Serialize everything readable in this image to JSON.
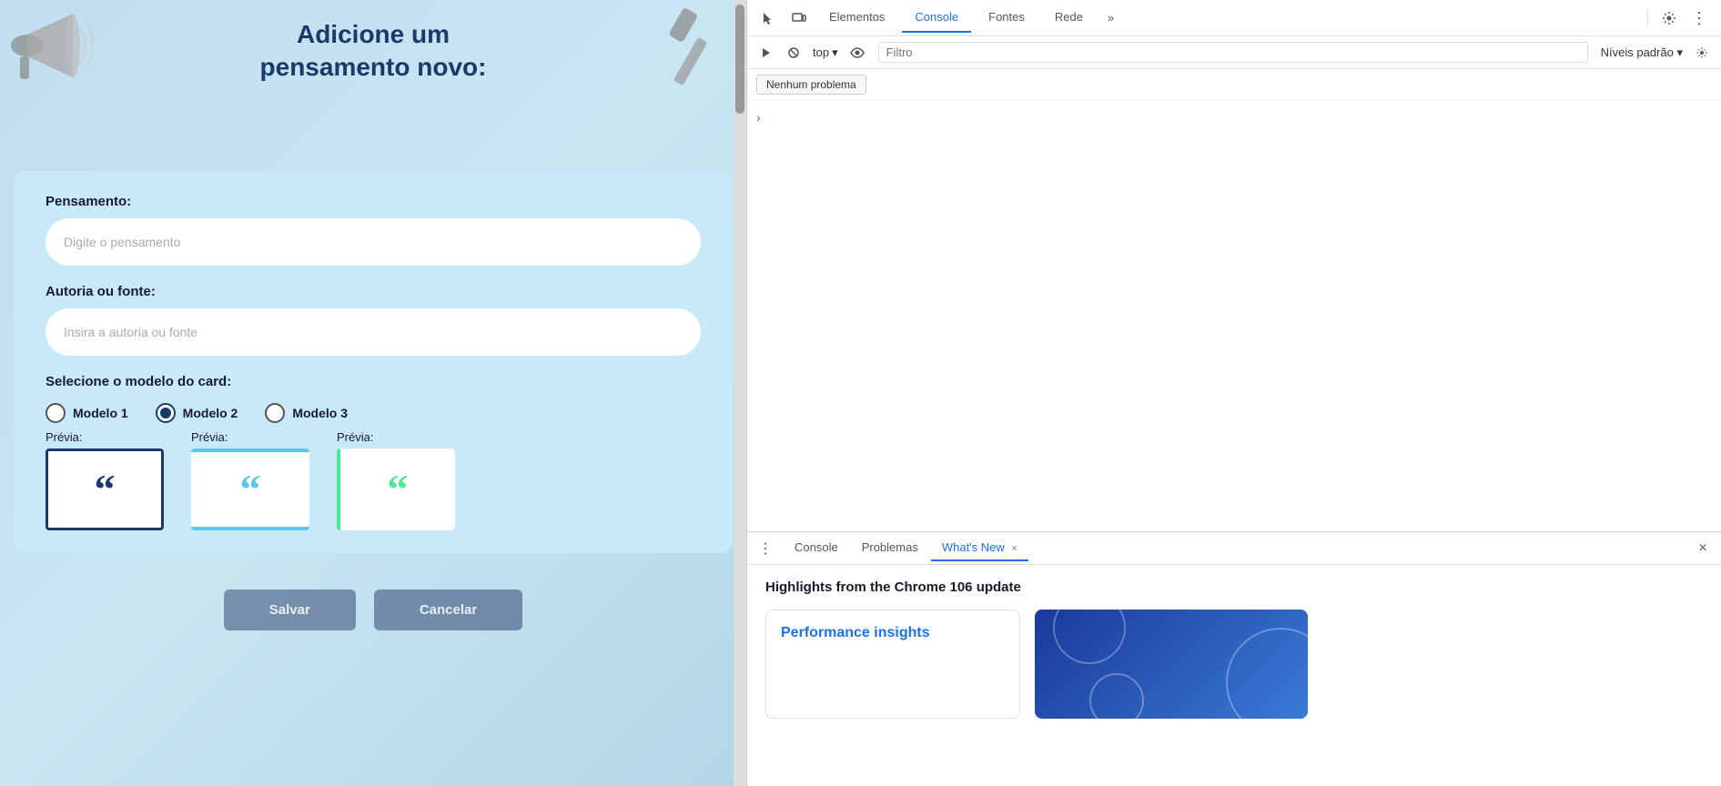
{
  "page": {
    "title_line1": "Adicione um",
    "title_line2": "pensamento novo:",
    "form": {
      "thought_label": "Pensamento:",
      "thought_placeholder": "Digite o pensamento",
      "author_label": "Autoria ou fonte:",
      "author_placeholder": "Insira a autoria ou fonte",
      "model_label": "Selecione o modelo do card:",
      "models": [
        {
          "id": "model1",
          "label": "Modelo 1",
          "selected": false
        },
        {
          "id": "model2",
          "label": "Modelo 2",
          "selected": true
        },
        {
          "id": "model3",
          "label": "Modelo 3",
          "selected": false
        }
      ],
      "preview_label": "Prévia:",
      "save_button": "Salvar",
      "cancel_button": "Cancelar"
    }
  },
  "devtools": {
    "tabs": [
      {
        "id": "elementos",
        "label": "Elementos",
        "active": false
      },
      {
        "id": "console",
        "label": "Console",
        "active": true
      },
      {
        "id": "fontes",
        "label": "Fontes",
        "active": false
      },
      {
        "id": "rede",
        "label": "Rede",
        "active": false
      }
    ],
    "more_tabs": "»",
    "toolbar": {
      "top_label": "top",
      "filter_placeholder": "Filtro",
      "levels_label": "Níveis padrão"
    },
    "no_problem_btn": "Nenhum problema",
    "console_output": {
      "has_arrow": true
    }
  },
  "bottom_panel": {
    "tabs": [
      {
        "id": "console",
        "label": "Console",
        "active": false,
        "closeable": false
      },
      {
        "id": "problemas",
        "label": "Problemas",
        "active": false,
        "closeable": false
      },
      {
        "id": "whats-new",
        "label": "What's New",
        "active": true,
        "closeable": true
      }
    ],
    "whats_new": {
      "heading": "Highlights from the Chrome 106 update",
      "card1_label": "Performance insights",
      "card1_accent_color": "#1a73e8"
    }
  },
  "icons": {
    "cursor": "⊹",
    "screen": "⬜",
    "gear": "⚙",
    "dots_vertical": "⋮",
    "play": "▶",
    "ban": "⊘",
    "eye": "👁",
    "arrow_right": "›",
    "close": "×",
    "chevron_down": "▾"
  }
}
